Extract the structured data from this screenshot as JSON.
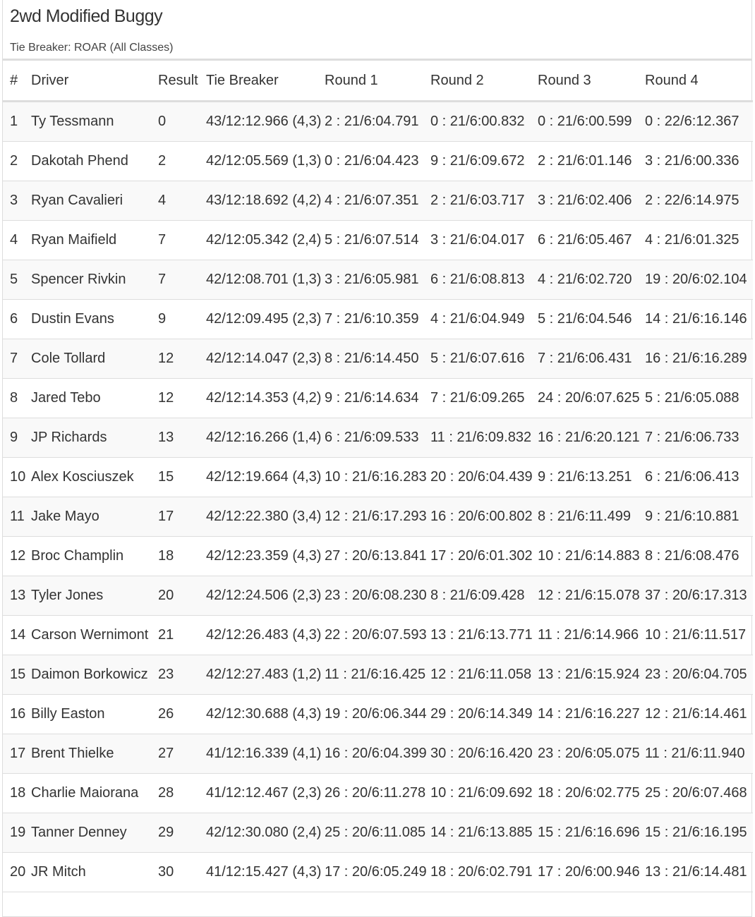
{
  "title": "2wd Modified Buggy",
  "subtitle": "Tie Breaker: ROAR (All Classes)",
  "columns": [
    "#",
    "Driver",
    "Result",
    "Tie Breaker",
    "Round 1",
    "Round 2",
    "Round 3",
    "Round 4"
  ],
  "rows": [
    [
      "1",
      "Ty Tessmann",
      "0",
      "43/12:12.966 (4,3)",
      "2 : 21/6:04.791",
      "0 : 21/6:00.832",
      "0 : 21/6:00.599",
      "0 : 22/6:12.367"
    ],
    [
      "2",
      "Dakotah Phend",
      "2",
      "42/12:05.569 (1,3)",
      "0 : 21/6:04.423",
      "9 : 21/6:09.672",
      "2 : 21/6:01.146",
      "3 : 21/6:00.336"
    ],
    [
      "3",
      "Ryan Cavalieri",
      "4",
      "43/12:18.692 (4,2)",
      "4 : 21/6:07.351",
      "2 : 21/6:03.717",
      "3 : 21/6:02.406",
      "2 : 22/6:14.975"
    ],
    [
      "4",
      "Ryan Maifield",
      "7",
      "42/12:05.342 (2,4)",
      "5 : 21/6:07.514",
      "3 : 21/6:04.017",
      "6 : 21/6:05.467",
      "4 : 21/6:01.325"
    ],
    [
      "5",
      "Spencer Rivkin",
      "7",
      "42/12:08.701 (1,3)",
      "3 : 21/6:05.981",
      "6 : 21/6:08.813",
      "4 : 21/6:02.720",
      "19 : 20/6:02.104"
    ],
    [
      "6",
      "Dustin Evans",
      "9",
      "42/12:09.495 (2,3)",
      "7 : 21/6:10.359",
      "4 : 21/6:04.949",
      "5 : 21/6:04.546",
      "14 : 21/6:16.146"
    ],
    [
      "7",
      "Cole Tollard",
      "12",
      "42/12:14.047 (2,3)",
      "8 : 21/6:14.450",
      "5 : 21/6:07.616",
      "7 : 21/6:06.431",
      "16 : 21/6:16.289"
    ],
    [
      "8",
      "Jared Tebo",
      "12",
      "42/12:14.353 (4,2)",
      "9 : 21/6:14.634",
      "7 : 21/6:09.265",
      "24 : 20/6:07.625",
      "5 : 21/6:05.088"
    ],
    [
      "9",
      "JP Richards",
      "13",
      "42/12:16.266 (1,4)",
      "6 : 21/6:09.533",
      "11 : 21/6:09.832",
      "16 : 21/6:20.121",
      "7 : 21/6:06.733"
    ],
    [
      "10",
      "Alex Kosciuszek",
      "15",
      "42/12:19.664 (4,3)",
      "10 : 21/6:16.283",
      "20 : 20/6:04.439",
      "9 : 21/6:13.251",
      "6 : 21/6:06.413"
    ],
    [
      "11",
      "Jake Mayo",
      "17",
      "42/12:22.380 (3,4)",
      "12 : 21/6:17.293",
      "16 : 20/6:00.802",
      "8 : 21/6:11.499",
      "9 : 21/6:10.881"
    ],
    [
      "12",
      "Broc Champlin",
      "18",
      "42/12:23.359 (4,3)",
      "27 : 20/6:13.841",
      "17 : 20/6:01.302",
      "10 : 21/6:14.883",
      "8 : 21/6:08.476"
    ],
    [
      "13",
      "Tyler Jones",
      "20",
      "42/12:24.506 (2,3)",
      "23 : 20/6:08.230",
      "8 : 21/6:09.428",
      "12 : 21/6:15.078",
      "37 : 20/6:17.313"
    ],
    [
      "14",
      "Carson Wernimont",
      "21",
      "42/12:26.483 (4,3)",
      "22 : 20/6:07.593",
      "13 : 21/6:13.771",
      "11 : 21/6:14.966",
      "10 : 21/6:11.517"
    ],
    [
      "15",
      "Daimon Borkowicz",
      "23",
      "42/12:27.483 (1,2)",
      "11 : 21/6:16.425",
      "12 : 21/6:11.058",
      "13 : 21/6:15.924",
      "23 : 20/6:04.705"
    ],
    [
      "16",
      "Billy Easton",
      "26",
      "42/12:30.688 (4,3)",
      "19 : 20/6:06.344",
      "29 : 20/6:14.349",
      "14 : 21/6:16.227",
      "12 : 21/6:14.461"
    ],
    [
      "17",
      "Brent Thielke",
      "27",
      "41/12:16.339 (4,1)",
      "16 : 20/6:04.399",
      "30 : 20/6:16.420",
      "23 : 20/6:05.075",
      "11 : 21/6:11.940"
    ],
    [
      "18",
      "Charlie Maiorana",
      "28",
      "41/12:12.467 (2,3)",
      "26 : 20/6:11.278",
      "10 : 21/6:09.692",
      "18 : 20/6:02.775",
      "25 : 20/6:07.468"
    ],
    [
      "19",
      "Tanner Denney",
      "29",
      "42/12:30.080 (2,4)",
      "25 : 20/6:11.085",
      "14 : 21/6:13.885",
      "15 : 21/6:16.696",
      "15 : 21/6:16.195"
    ],
    [
      "20",
      "JR Mitch",
      "30",
      "41/12:15.427 (4,3)",
      "17 : 20/6:05.249",
      "18 : 20/6:02.791",
      "17 : 20/6:00.946",
      "13 : 21/6:14.481"
    ]
  ]
}
